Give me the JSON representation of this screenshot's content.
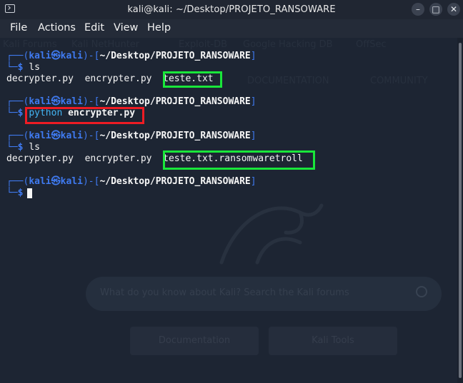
{
  "window": {
    "title": "kali@kali: ~/Desktop/PROJETO_RANSOWARE",
    "buttons": {
      "minimize": "–",
      "maximize": "□",
      "close": "✕"
    }
  },
  "menu": [
    "File",
    "Actions",
    "Edit",
    "View",
    "Help"
  ],
  "terminal": {
    "prompt": {
      "user": "kali",
      "host": "kali",
      "path": "~/Desktop/PROJETO_RANSOWARE"
    },
    "blocks": [
      {
        "command": "ls",
        "output": [
          "decrypter.py",
          "encrypter.py",
          "teste.txt"
        ]
      },
      {
        "command_prog": "python",
        "command_arg": "encrypter.py"
      },
      {
        "command": "ls",
        "output": [
          "decrypter.py",
          "encrypter.py",
          "teste.txt.ransomwaretroll"
        ]
      },
      {
        "command": ""
      }
    ]
  },
  "background_ghost": {
    "row1": [
      "Kali Forums",
      "Kali NetHunter",
      "Exploit-DB",
      "Google Hacking DB",
      "OffSec"
    ],
    "nav": [
      "DOCUMENTATION",
      "COMMUNITY"
    ],
    "search_placeholder": "What do you know about Kali? Search the Kali forums",
    "buttons": [
      "Documentation",
      "Kali Tools"
    ]
  },
  "colors": {
    "highlight_green": "#19e63a",
    "highlight_red": "#ee1c24",
    "prompt_blue": "#3f7af0",
    "cmd_cyan": "#44b4f2"
  }
}
